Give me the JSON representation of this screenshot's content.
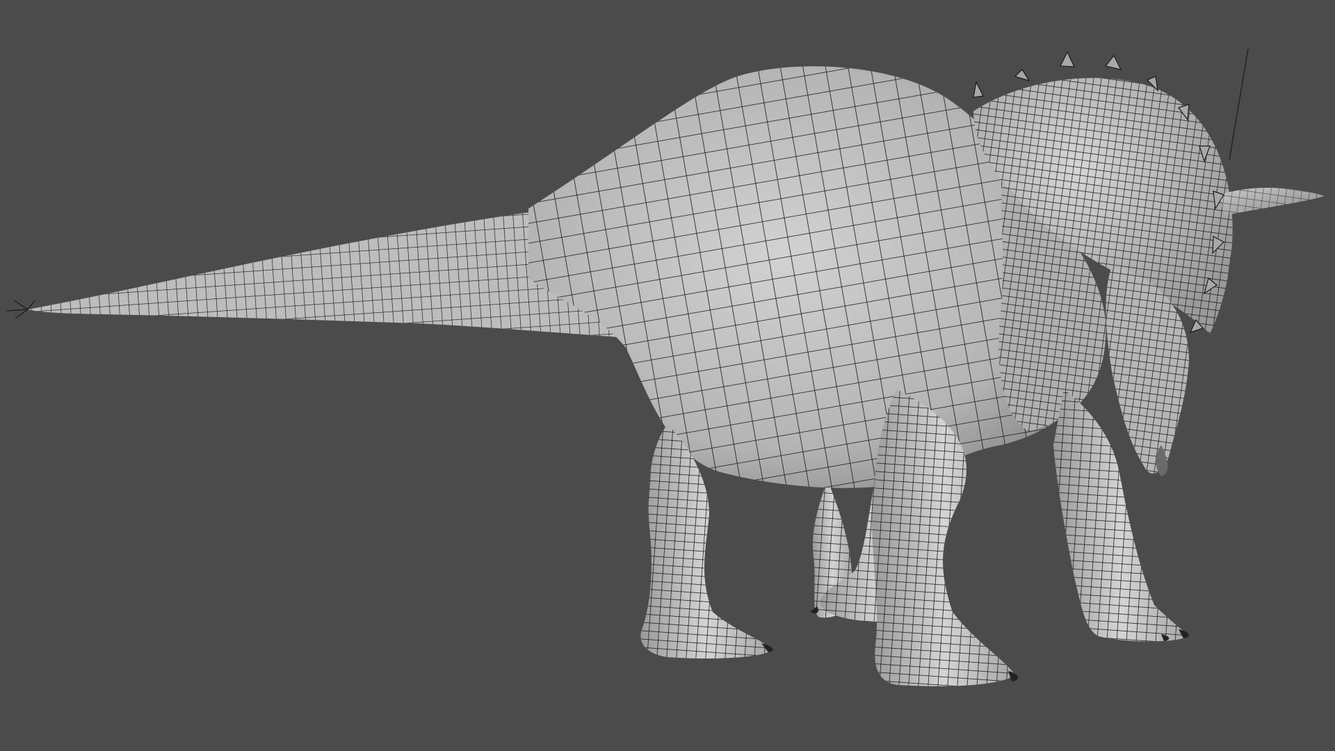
{
  "viewport": {
    "background_color": "#4b4b4b",
    "mesh_fill_light": "#c4c4c4",
    "mesh_fill_dark": "#8e8e8e",
    "wire_color": "#141414",
    "claw_color": "#222222",
    "subject": "triceratops-wireframe-mesh"
  }
}
